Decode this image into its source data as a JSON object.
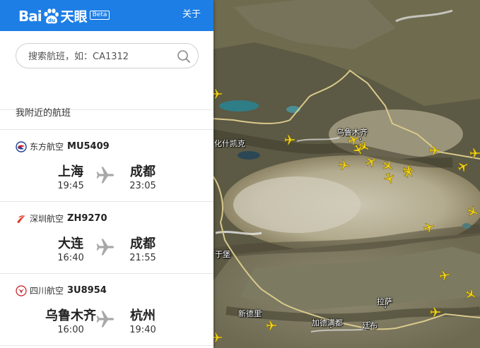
{
  "header": {
    "logo_text_bai": "Bai",
    "logo_text_tianyan": "天眼",
    "beta_badge": "Beta",
    "about_link": "关于"
  },
  "search": {
    "placeholder": "搜索航班，如：CA1312",
    "value": "",
    "icon": "search-icon"
  },
  "nearby": {
    "title": "我附近的航班",
    "flights": [
      {
        "airline": "东方航空",
        "flight_no": "MU5409",
        "airline_icon": "china-eastern-logo-icon",
        "airline_color": "#c8202b",
        "from_city": "上海",
        "depart_time": "19:45",
        "to_city": "成都",
        "arrive_time": "23:05"
      },
      {
        "airline": "深圳航空",
        "flight_no": "ZH9270",
        "airline_icon": "shenzhen-airlines-logo-icon",
        "airline_color": "#e0331f",
        "from_city": "大连",
        "depart_time": "16:40",
        "to_city": "成都",
        "arrive_time": "21:55"
      },
      {
        "airline": "四川航空",
        "flight_no": "3U8954",
        "airline_icon": "sichuan-airlines-logo-icon",
        "airline_color": "#c9161d",
        "from_city": "乌鲁木齐",
        "depart_time": "16:00",
        "to_city": "杭州",
        "arrive_time": "19:40"
      }
    ]
  },
  "map": {
    "labels": {
      "urumqi": "乌鲁木齐",
      "kashgar": "化什凯克",
      "kargil": "于堡",
      "lhasa": "拉萨",
      "new_delhi": "新德里",
      "kathmandu": "加德满都",
      "thimphu": "廷布"
    },
    "plane_color": "#f2d21b",
    "border_color": "#d9c98c"
  },
  "colors": {
    "brand_blue": "#1d7ee6",
    "text_dark": "#222222"
  }
}
